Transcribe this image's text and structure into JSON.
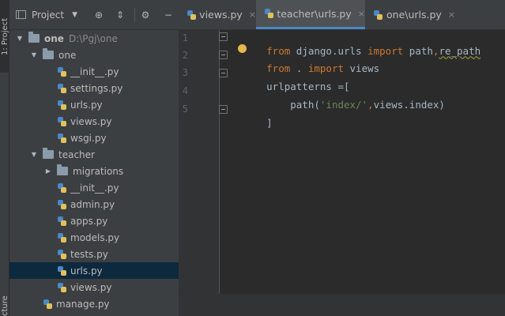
{
  "sidebar_strip": {
    "project_tab": "1: Project",
    "structure_tab": "cture"
  },
  "project_panel": {
    "title": "Project",
    "icons": [
      "target-icon",
      "collapse-icon",
      "gear-icon",
      "hide-icon"
    ]
  },
  "tree": [
    {
      "label": "one",
      "path": "D:\\Pgj\\one",
      "kind": "folder",
      "expanded": true,
      "bold": true
    },
    {
      "label": "one",
      "kind": "folder",
      "expanded": true
    },
    {
      "label": "__init__.py",
      "kind": "py"
    },
    {
      "label": "settings.py",
      "kind": "py"
    },
    {
      "label": "urls.py",
      "kind": "py"
    },
    {
      "label": "views.py",
      "kind": "py"
    },
    {
      "label": "wsgi.py",
      "kind": "py"
    },
    {
      "label": "teacher",
      "kind": "folder",
      "expanded": true
    },
    {
      "label": "migrations",
      "kind": "folder",
      "expanded": false
    },
    {
      "label": "__init__.py",
      "kind": "py"
    },
    {
      "label": "admin.py",
      "kind": "py"
    },
    {
      "label": "apps.py",
      "kind": "py"
    },
    {
      "label": "models.py",
      "kind": "py"
    },
    {
      "label": "tests.py",
      "kind": "py"
    },
    {
      "label": "urls.py",
      "kind": "py",
      "selected": true
    },
    {
      "label": "views.py",
      "kind": "py"
    },
    {
      "label": "manage.py",
      "kind": "py"
    }
  ],
  "editor": {
    "tabs": [
      {
        "label": "views.py",
        "close": "×",
        "active": false
      },
      {
        "label": "teacher\\urls.py",
        "close": "×",
        "active": true
      },
      {
        "label": "one\\urls.py",
        "close": "×",
        "active": false
      }
    ],
    "line_numbers": [
      "1",
      "2",
      "3",
      "4",
      "5"
    ],
    "code": {
      "l1_kw1": "from",
      "l1_mod": " django.urls ",
      "l1_kw2": "import",
      "l1_names": " path",
      "l1_comma": ",",
      "l1_repath": "re_path",
      "l2_kw1": "from",
      "l2_dot": " . ",
      "l2_kw2": "import",
      "l2_views": " views",
      "l3_text": "urlpatterns =[",
      "l4_indent": "    path(",
      "l4_str": "'index/'",
      "l4_comma": ",",
      "l4_rest": "views.index)",
      "l5_text": "]"
    }
  },
  "colors": {
    "keyword": "#cc7832",
    "string": "#6a8759",
    "plain": "#a9b7c6",
    "selection": "#0d293e",
    "accent": "#4a88c7"
  }
}
